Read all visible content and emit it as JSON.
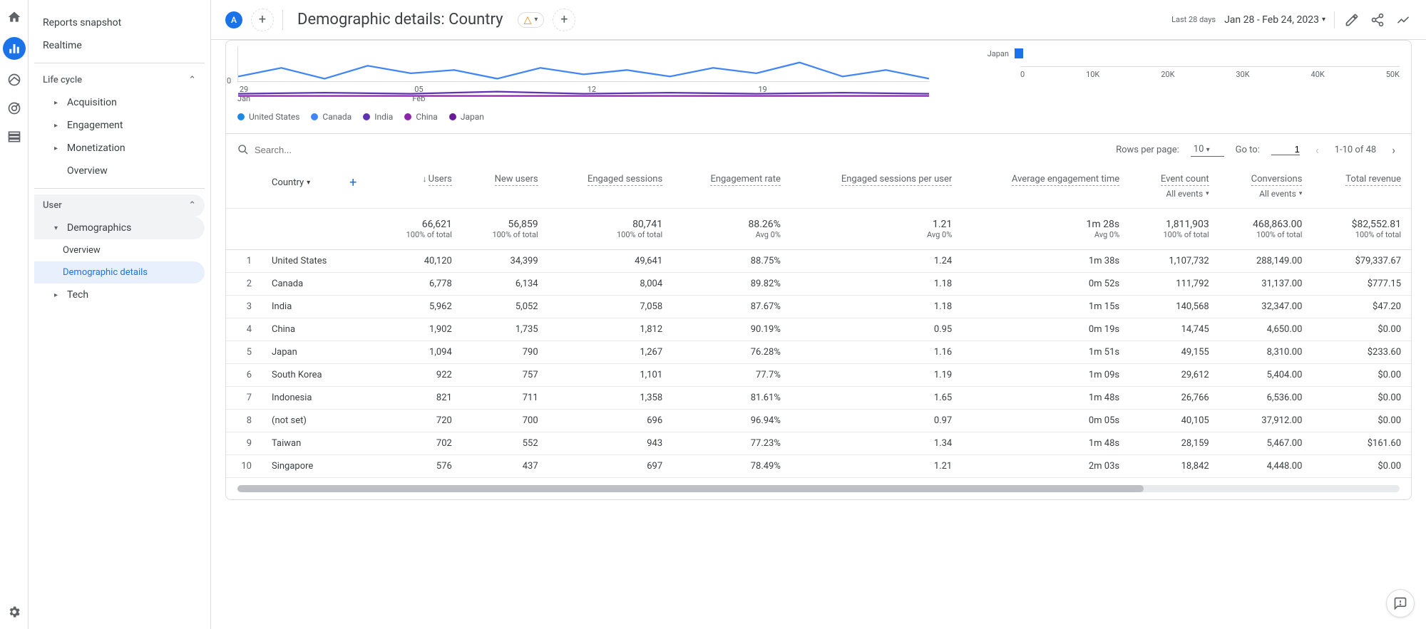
{
  "sidebar": {
    "top": [
      "Reports snapshot",
      "Realtime"
    ],
    "life_cycle": {
      "label": "Life cycle",
      "items": [
        "Acquisition",
        "Engagement",
        "Monetization",
        "Overview"
      ]
    },
    "user": {
      "label": "User",
      "demographics": {
        "label": "Demographics",
        "items": [
          "Overview",
          "Demographic details"
        ]
      },
      "tech": "Tech"
    }
  },
  "header": {
    "avatar": "A",
    "title": "Demographic details: Country",
    "date_label": "Last 28 days",
    "date_range": "Jan 28 - Feb 24, 2023"
  },
  "chart_data": {
    "line": {
      "type": "line",
      "x_ticks": [
        {
          "top": "29",
          "bottom": "Jan"
        },
        {
          "top": "05",
          "bottom": "Feb"
        },
        {
          "top": "12",
          "bottom": ""
        },
        {
          "top": "19",
          "bottom": ""
        }
      ],
      "y_zero": "0",
      "series": [
        {
          "name": "United States",
          "color": "#1e88e5"
        },
        {
          "name": "Canada",
          "color": "#4285f4"
        },
        {
          "name": "India",
          "color": "#5e35b1"
        },
        {
          "name": "China",
          "color": "#8e24aa"
        },
        {
          "name": "Japan",
          "color": "#6a1b9a"
        }
      ]
    },
    "bar": {
      "type": "bar",
      "label": "Japan",
      "value": 1094,
      "axis": [
        "0",
        "10K",
        "20K",
        "30K",
        "40K",
        "50K"
      ],
      "max": 50000
    }
  },
  "toolbar": {
    "search_placeholder": "Search...",
    "rows_label": "Rows per page:",
    "rows_value": "10",
    "goto_label": "Go to:",
    "goto_value": "1",
    "range": "1-10 of 48"
  },
  "table": {
    "dim_header": "Country",
    "columns": [
      {
        "label": "Users",
        "sorted": true
      },
      {
        "label": "New users"
      },
      {
        "label": "Engaged sessions"
      },
      {
        "label": "Engagement rate"
      },
      {
        "label": "Engaged sessions per user"
      },
      {
        "label": "Average engagement time"
      },
      {
        "label": "Event count",
        "sub": "All events"
      },
      {
        "label": "Conversions",
        "sub": "All events"
      },
      {
        "label": "Total revenue"
      }
    ],
    "totals": {
      "values": [
        "66,621",
        "56,859",
        "80,741",
        "88.26%",
        "1.21",
        "1m 28s",
        "1,811,903",
        "468,863.00",
        "$82,552.81"
      ],
      "subs": [
        "100% of total",
        "100% of total",
        "100% of total",
        "Avg 0%",
        "Avg 0%",
        "Avg 0%",
        "100% of total",
        "100% of total",
        "100% of total"
      ]
    },
    "rows": [
      {
        "n": "1",
        "dim": "United States",
        "v": [
          "40,120",
          "34,399",
          "49,641",
          "88.75%",
          "1.24",
          "1m 38s",
          "1,107,732",
          "288,149.00",
          "$79,337.67"
        ]
      },
      {
        "n": "2",
        "dim": "Canada",
        "v": [
          "6,778",
          "6,134",
          "8,004",
          "89.82%",
          "1.18",
          "0m 52s",
          "111,792",
          "31,137.00",
          "$777.15"
        ]
      },
      {
        "n": "3",
        "dim": "India",
        "v": [
          "5,962",
          "5,052",
          "7,058",
          "87.67%",
          "1.18",
          "1m 15s",
          "140,568",
          "32,347.00",
          "$47.20"
        ]
      },
      {
        "n": "4",
        "dim": "China",
        "v": [
          "1,902",
          "1,735",
          "1,812",
          "90.19%",
          "0.95",
          "0m 19s",
          "14,745",
          "4,650.00",
          "$0.00"
        ]
      },
      {
        "n": "5",
        "dim": "Japan",
        "v": [
          "1,094",
          "790",
          "1,267",
          "76.28%",
          "1.16",
          "1m 51s",
          "49,155",
          "8,310.00",
          "$233.60"
        ]
      },
      {
        "n": "6",
        "dim": "South Korea",
        "v": [
          "922",
          "757",
          "1,101",
          "77.7%",
          "1.19",
          "1m 09s",
          "29,612",
          "5,404.00",
          "$0.00"
        ]
      },
      {
        "n": "7",
        "dim": "Indonesia",
        "v": [
          "821",
          "711",
          "1,358",
          "81.61%",
          "1.65",
          "1m 48s",
          "26,766",
          "6,536.00",
          "$0.00"
        ]
      },
      {
        "n": "8",
        "dim": "(not set)",
        "v": [
          "720",
          "700",
          "696",
          "96.94%",
          "0.97",
          "0m 05s",
          "40,105",
          "37,912.00",
          "$0.00"
        ]
      },
      {
        "n": "9",
        "dim": "Taiwan",
        "v": [
          "702",
          "552",
          "943",
          "77.23%",
          "1.34",
          "1m 48s",
          "28,159",
          "5,467.00",
          "$161.60"
        ]
      },
      {
        "n": "10",
        "dim": "Singapore",
        "v": [
          "576",
          "437",
          "697",
          "78.49%",
          "1.21",
          "2m 03s",
          "18,842",
          "4,448.00",
          "$0.00"
        ]
      }
    ]
  }
}
